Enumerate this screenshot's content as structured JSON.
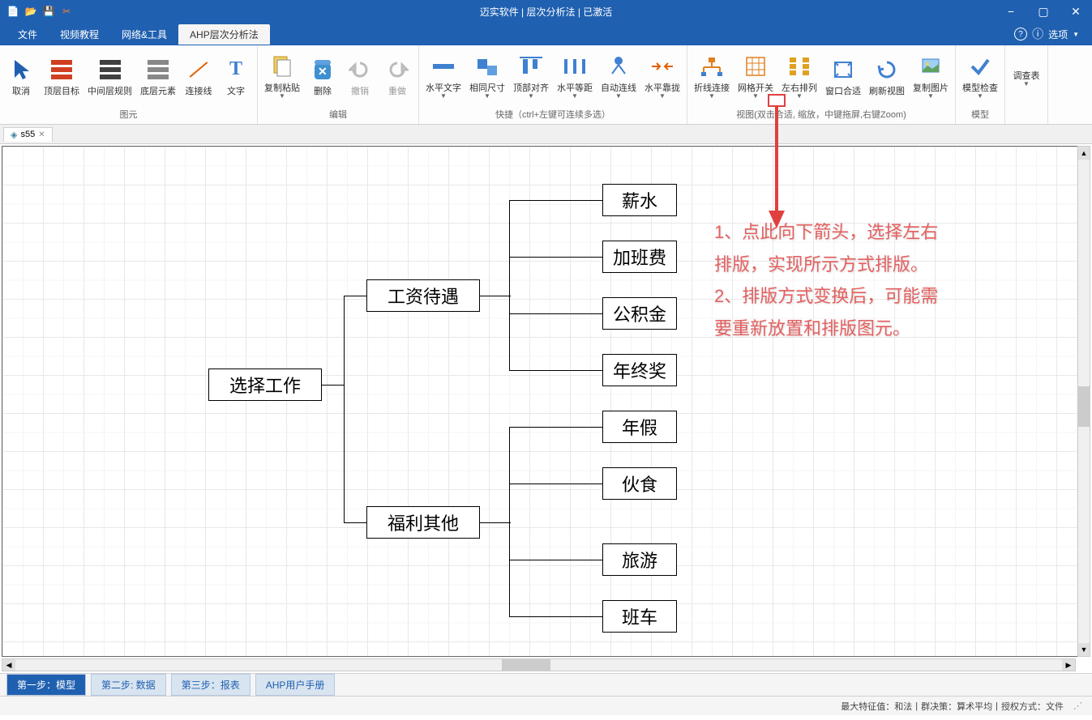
{
  "title": "迈实软件 | 层次分析法 | 已激活",
  "menu": {
    "items": [
      "文件",
      "视频教程",
      "网络&工具",
      "AHP层次分析法"
    ],
    "activeIndex": 3,
    "options": "选项"
  },
  "ribbon": {
    "groups": [
      {
        "label": "图元",
        "buttons": [
          {
            "label": "取消",
            "icon": "cursor"
          },
          {
            "label": "顶层目标",
            "icon": "bars-red"
          },
          {
            "label": "中间层规则",
            "icon": "bars-dark"
          },
          {
            "label": "底层元素",
            "icon": "bars-gray"
          },
          {
            "label": "连接线",
            "icon": "line"
          },
          {
            "label": "文字",
            "icon": "text"
          }
        ]
      },
      {
        "label": "编辑",
        "buttons": [
          {
            "label": "复制粘贴",
            "icon": "copy",
            "arrow": true
          },
          {
            "label": "删除",
            "icon": "delete"
          },
          {
            "label": "撤销",
            "icon": "undo",
            "disabled": true
          },
          {
            "label": "重做",
            "icon": "redo",
            "disabled": true
          }
        ]
      },
      {
        "label": "快捷（ctrl+左键可连续多选）",
        "buttons": [
          {
            "label": "水平文字",
            "icon": "htext",
            "arrow": true
          },
          {
            "label": "相同尺寸",
            "icon": "samesize",
            "arrow": true
          },
          {
            "label": "顶部对齐",
            "icon": "topalign",
            "arrow": true
          },
          {
            "label": "水平等距",
            "icon": "hspace",
            "arrow": true
          },
          {
            "label": "自动连线",
            "icon": "autoconn",
            "arrow": true
          },
          {
            "label": "水平靠拢",
            "icon": "hclose",
            "arrow": true
          }
        ]
      },
      {
        "label": "视图(双击合适,     缩放，中键拖屏,右键Zoom)",
        "buttons": [
          {
            "label": "折线连接",
            "icon": "polyconn",
            "arrow": true
          },
          {
            "label": "网格开关",
            "icon": "grid",
            "arrow": true
          },
          {
            "label": "左右排列",
            "icon": "lrlayout",
            "arrow": true
          },
          {
            "label": "窗口合适",
            "icon": "fitwin"
          },
          {
            "label": "刷新视图",
            "icon": "refresh"
          },
          {
            "label": "复制图片",
            "icon": "copypic",
            "arrow": true
          }
        ]
      },
      {
        "label": "模型",
        "buttons": [
          {
            "label": "模型检查",
            "icon": "check",
            "arrow": true
          }
        ]
      },
      {
        "label": "",
        "buttons": [
          {
            "label": "调查表",
            "icon": "",
            "arrow": true,
            "textonly": true
          }
        ]
      }
    ]
  },
  "docTab": {
    "name": "s55"
  },
  "diagram": {
    "root": "选择工作",
    "mid": [
      "工资待遇",
      "福利其他"
    ],
    "leaves1": [
      "薪水",
      "加班费",
      "公积金",
      "年终奖"
    ],
    "leaves2": [
      "年假",
      "伙食",
      "旅游",
      "班车"
    ]
  },
  "annotation": {
    "text1": "1、点此向下箭头，选择左右",
    "text2": "排版，实现所示方式排版。",
    "text3": "2、排版方式变换后，可能需",
    "text4": "要重新放置和排版图元。"
  },
  "bottomTabs": [
    "第一步：模型",
    "第二步: 数据",
    "第三步：报表",
    "AHP用户手册"
  ],
  "status": {
    "maxEigen": "最大特征值：和法",
    "groupStrategy": "群决策：算术平均",
    "auth": "授权方式：文件"
  }
}
